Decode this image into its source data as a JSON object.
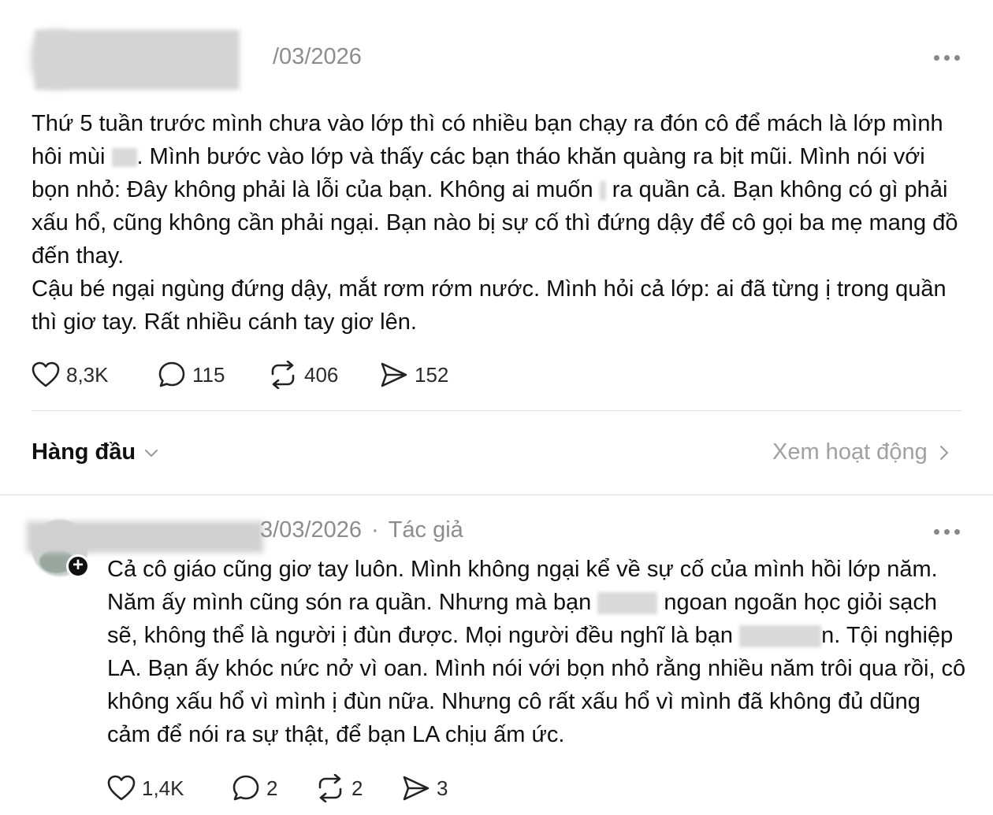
{
  "post": {
    "date": "/03/2026",
    "paragraph1": "Thứ 5 tuần trước mình chưa vào lớp thì có nhiều bạn chạy ra đón cô để mách là lớp mình hôi mùi ",
    "paragraph1b": ". Mình bước vào lớp và thấy các bạn tháo khăn quàng ra bịt mũi. Mình nói với bọn nhỏ: Đây không phải là lỗi của bạn. Không ai muốn ",
    "paragraph1c": " ra quần cả. Bạn không có gì phải xấu hổ, cũng không cần phải ngại. Bạn nào bị sự cố thì đứng dậy để cô gọi ba mẹ mang đồ đến thay.",
    "paragraph2": "Cậu bé ngại ngùng đứng dậy, mắt rơm rớm nước. Mình hỏi cả lớp: ai đã từng ị trong quần thì giơ tay. Rất nhiều cánh tay giơ lên.",
    "likes": "8,3K",
    "comments": "115",
    "reposts": "406",
    "shares": "152"
  },
  "sort_bar": {
    "sort_label": "Hàng đầu",
    "activity_label": "Xem hoạt động"
  },
  "reply": {
    "date": "3/03/2026",
    "separator": "·",
    "author_tag": "Tác giả",
    "text_a": "Cả cô giáo cũng giơ tay luôn. Mình không ngại kể về sự cố của mình hồi lớp năm. Năm ấy mình cũng són ra quần. Nhưng mà bạn ",
    "text_b": " ngoan ngoãn học giỏi sạch sẽ, không thể là người ị đùn được. Mọi người đều nghĩ là bạn ",
    "text_c": "n. Tội nghiệp LA. Bạn ấy khóc nức nở vì oan. Mình nói với bọn nhỏ rằng nhiều năm trôi qua rồi, cô không xấu hổ vì mình ị đùn nữa. Nhưng cô rất xấu hổ vì mình đã không đủ dũng cảm để nói ra sự thật, để bạn LA chịu ấm ức.",
    "likes": "1,4K",
    "comments": "2",
    "reposts": "2",
    "shares": "3"
  },
  "icons": [
    "heart-icon",
    "comment-icon",
    "repost-icon",
    "share-icon",
    "more-icon",
    "chevron-down-icon",
    "chevron-right-icon",
    "follow-plus-icon"
  ]
}
